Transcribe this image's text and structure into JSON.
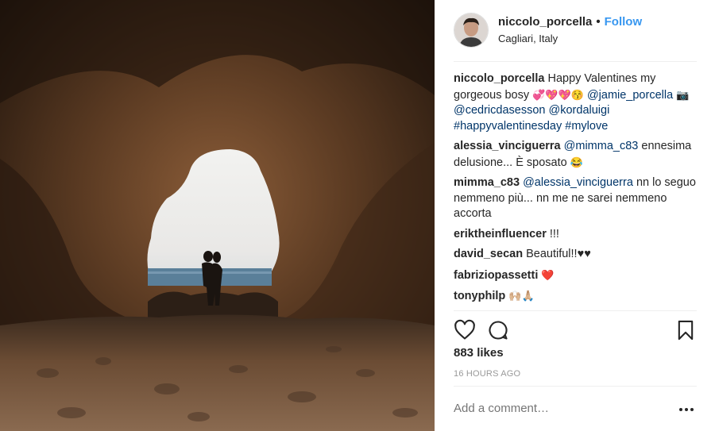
{
  "header": {
    "username": "niccolo_porcella",
    "separator": "•",
    "follow_label": "Follow",
    "location": "Cagliari, Italy"
  },
  "caption": {
    "username": "niccolo_porcella",
    "text": "Happy Valentines my gorgeous bosy",
    "emojis": "💞💖💖😚",
    "mention1": "@jamie_porcella",
    "camera": "📷",
    "mention2": "@cedricdasesson",
    "mention3": "@kordaluigi",
    "hashtag1": "#happyvalentinesday",
    "hashtag2": "#mylove"
  },
  "comments": [
    {
      "username": "alessia_vinciguerra",
      "mention": "@mimma_c83",
      "text": "ennesima delusione... È sposato",
      "emoji": "😂"
    },
    {
      "username": "mimma_c83",
      "mention": "@alessia_vinciguerra",
      "text": "nn lo seguo nemmeno più... nn me ne sarei nemmeno accorta"
    },
    {
      "username": "eriktheinfluencer",
      "text": "!!!"
    },
    {
      "username": "david_secan",
      "text": "Beautiful!!♥♥"
    },
    {
      "username": "fabriziopassetti",
      "emoji": "❤️"
    },
    {
      "username": "tonyphilp",
      "emoji": "🙌🏼🙏🏼"
    }
  ],
  "actions": {
    "like_icon": "heart-icon",
    "comment_icon": "comment-icon",
    "save_icon": "bookmark-icon"
  },
  "likes": "883 likes",
  "timestamp": "16 HOURS AGO",
  "add_comment": {
    "placeholder": "Add a comment…",
    "more_icon": "ellipsis-icon"
  },
  "colors": {
    "link": "#003569",
    "follow": "#3897f0",
    "timestamp": "#999999"
  }
}
